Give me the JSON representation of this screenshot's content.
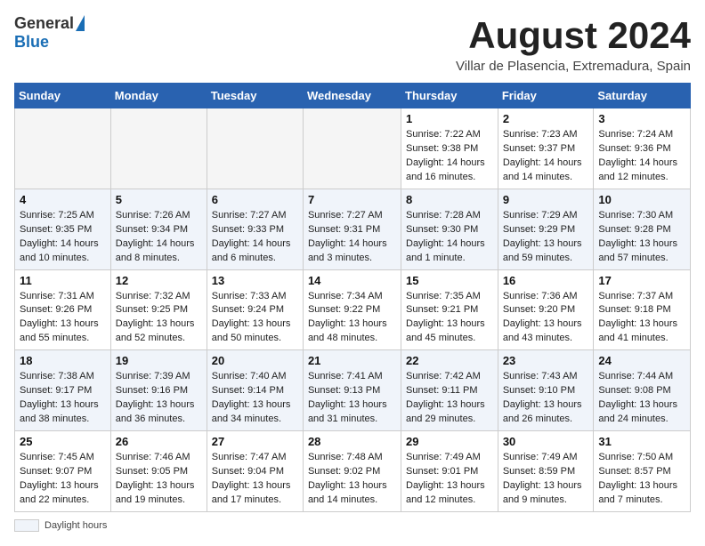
{
  "header": {
    "logo_general": "General",
    "logo_blue": "Blue",
    "month_title": "August 2024",
    "subtitle": "Villar de Plasencia, Extremadura, Spain"
  },
  "columns": [
    "Sunday",
    "Monday",
    "Tuesday",
    "Wednesday",
    "Thursday",
    "Friday",
    "Saturday"
  ],
  "weeks": [
    [
      {
        "day": "",
        "info": ""
      },
      {
        "day": "",
        "info": ""
      },
      {
        "day": "",
        "info": ""
      },
      {
        "day": "",
        "info": ""
      },
      {
        "day": "1",
        "info": "Sunrise: 7:22 AM\nSunset: 9:38 PM\nDaylight: 14 hours and 16 minutes."
      },
      {
        "day": "2",
        "info": "Sunrise: 7:23 AM\nSunset: 9:37 PM\nDaylight: 14 hours and 14 minutes."
      },
      {
        "day": "3",
        "info": "Sunrise: 7:24 AM\nSunset: 9:36 PM\nDaylight: 14 hours and 12 minutes."
      }
    ],
    [
      {
        "day": "4",
        "info": "Sunrise: 7:25 AM\nSunset: 9:35 PM\nDaylight: 14 hours and 10 minutes."
      },
      {
        "day": "5",
        "info": "Sunrise: 7:26 AM\nSunset: 9:34 PM\nDaylight: 14 hours and 8 minutes."
      },
      {
        "day": "6",
        "info": "Sunrise: 7:27 AM\nSunset: 9:33 PM\nDaylight: 14 hours and 6 minutes."
      },
      {
        "day": "7",
        "info": "Sunrise: 7:27 AM\nSunset: 9:31 PM\nDaylight: 14 hours and 3 minutes."
      },
      {
        "day": "8",
        "info": "Sunrise: 7:28 AM\nSunset: 9:30 PM\nDaylight: 14 hours and 1 minute."
      },
      {
        "day": "9",
        "info": "Sunrise: 7:29 AM\nSunset: 9:29 PM\nDaylight: 13 hours and 59 minutes."
      },
      {
        "day": "10",
        "info": "Sunrise: 7:30 AM\nSunset: 9:28 PM\nDaylight: 13 hours and 57 minutes."
      }
    ],
    [
      {
        "day": "11",
        "info": "Sunrise: 7:31 AM\nSunset: 9:26 PM\nDaylight: 13 hours and 55 minutes."
      },
      {
        "day": "12",
        "info": "Sunrise: 7:32 AM\nSunset: 9:25 PM\nDaylight: 13 hours and 52 minutes."
      },
      {
        "day": "13",
        "info": "Sunrise: 7:33 AM\nSunset: 9:24 PM\nDaylight: 13 hours and 50 minutes."
      },
      {
        "day": "14",
        "info": "Sunrise: 7:34 AM\nSunset: 9:22 PM\nDaylight: 13 hours and 48 minutes."
      },
      {
        "day": "15",
        "info": "Sunrise: 7:35 AM\nSunset: 9:21 PM\nDaylight: 13 hours and 45 minutes."
      },
      {
        "day": "16",
        "info": "Sunrise: 7:36 AM\nSunset: 9:20 PM\nDaylight: 13 hours and 43 minutes."
      },
      {
        "day": "17",
        "info": "Sunrise: 7:37 AM\nSunset: 9:18 PM\nDaylight: 13 hours and 41 minutes."
      }
    ],
    [
      {
        "day": "18",
        "info": "Sunrise: 7:38 AM\nSunset: 9:17 PM\nDaylight: 13 hours and 38 minutes."
      },
      {
        "day": "19",
        "info": "Sunrise: 7:39 AM\nSunset: 9:16 PM\nDaylight: 13 hours and 36 minutes."
      },
      {
        "day": "20",
        "info": "Sunrise: 7:40 AM\nSunset: 9:14 PM\nDaylight: 13 hours and 34 minutes."
      },
      {
        "day": "21",
        "info": "Sunrise: 7:41 AM\nSunset: 9:13 PM\nDaylight: 13 hours and 31 minutes."
      },
      {
        "day": "22",
        "info": "Sunrise: 7:42 AM\nSunset: 9:11 PM\nDaylight: 13 hours and 29 minutes."
      },
      {
        "day": "23",
        "info": "Sunrise: 7:43 AM\nSunset: 9:10 PM\nDaylight: 13 hours and 26 minutes."
      },
      {
        "day": "24",
        "info": "Sunrise: 7:44 AM\nSunset: 9:08 PM\nDaylight: 13 hours and 24 minutes."
      }
    ],
    [
      {
        "day": "25",
        "info": "Sunrise: 7:45 AM\nSunset: 9:07 PM\nDaylight: 13 hours and 22 minutes."
      },
      {
        "day": "26",
        "info": "Sunrise: 7:46 AM\nSunset: 9:05 PM\nDaylight: 13 hours and 19 minutes."
      },
      {
        "day": "27",
        "info": "Sunrise: 7:47 AM\nSunset: 9:04 PM\nDaylight: 13 hours and 17 minutes."
      },
      {
        "day": "28",
        "info": "Sunrise: 7:48 AM\nSunset: 9:02 PM\nDaylight: 13 hours and 14 minutes."
      },
      {
        "day": "29",
        "info": "Sunrise: 7:49 AM\nSunset: 9:01 PM\nDaylight: 13 hours and 12 minutes."
      },
      {
        "day": "30",
        "info": "Sunrise: 7:49 AM\nSunset: 8:59 PM\nDaylight: 13 hours and 9 minutes."
      },
      {
        "day": "31",
        "info": "Sunrise: 7:50 AM\nSunset: 8:57 PM\nDaylight: 13 hours and 7 minutes."
      }
    ]
  ],
  "footer": {
    "daylight_label": "Daylight hours"
  }
}
